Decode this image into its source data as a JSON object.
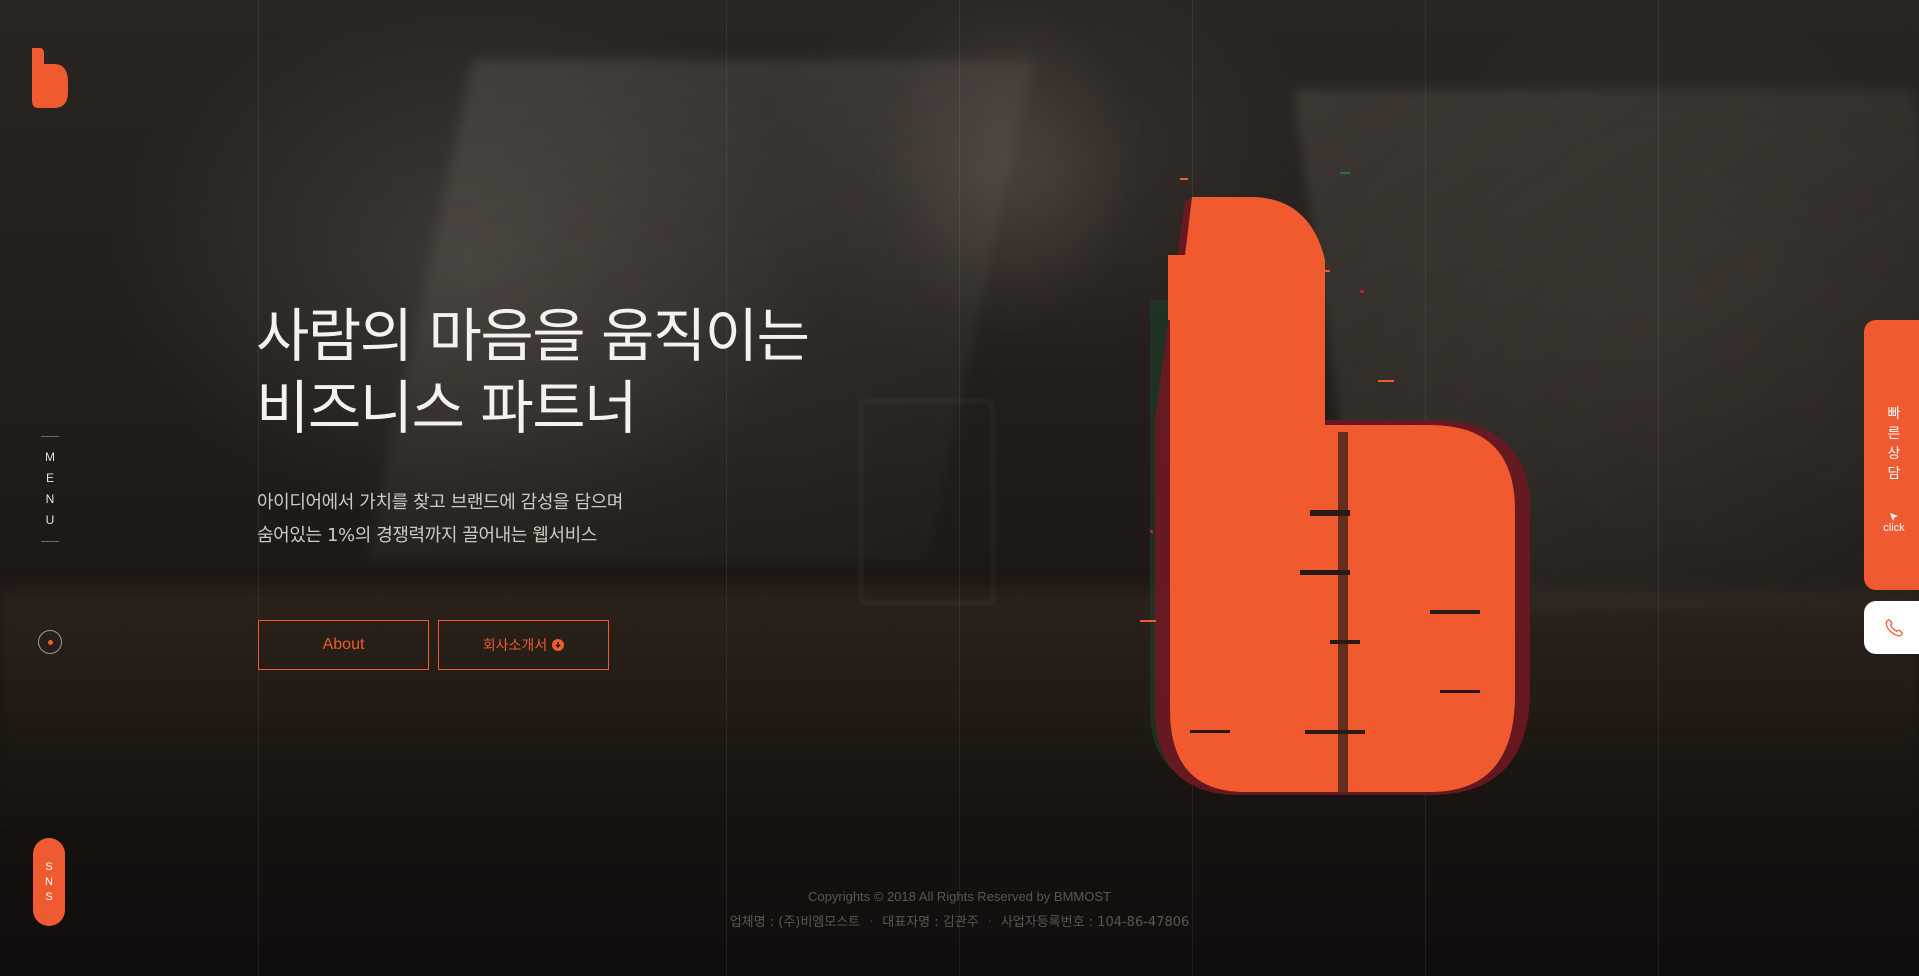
{
  "brand": {
    "logo_letter": "b",
    "accent_color": "#ef5a30"
  },
  "sidebar": {
    "menu_label": "MENU",
    "sns_label": "SNS"
  },
  "hero": {
    "title_line1": "사람의 마음을 움직이는",
    "title_line2": "비즈니스 파트너",
    "subtitle_line1": "아이디어에서 가치를 찾고 브랜드에 감성을 담으며",
    "subtitle_line2": "숨어있는 1%의 경쟁력까지 끌어내는 웹서비스",
    "about_button": "About",
    "brochure_button": "회사소개서"
  },
  "right_tabs": {
    "consult_label": "빠른상담",
    "click_label": "click",
    "phone_icon": "phone-icon"
  },
  "footer": {
    "copyright": "Copyrights © 2018 All Rights Reserved by BMMOST",
    "company": "업체명 : (주)비엠모스트",
    "ceo": "대표자명 : 김관주",
    "business_no": "사업자등록번호 : 104-86-47806"
  },
  "icons": {
    "download": "download-circle-icon",
    "cursor": "cursor-arrow-icon",
    "scroll": "scroll-indicator-icon"
  }
}
